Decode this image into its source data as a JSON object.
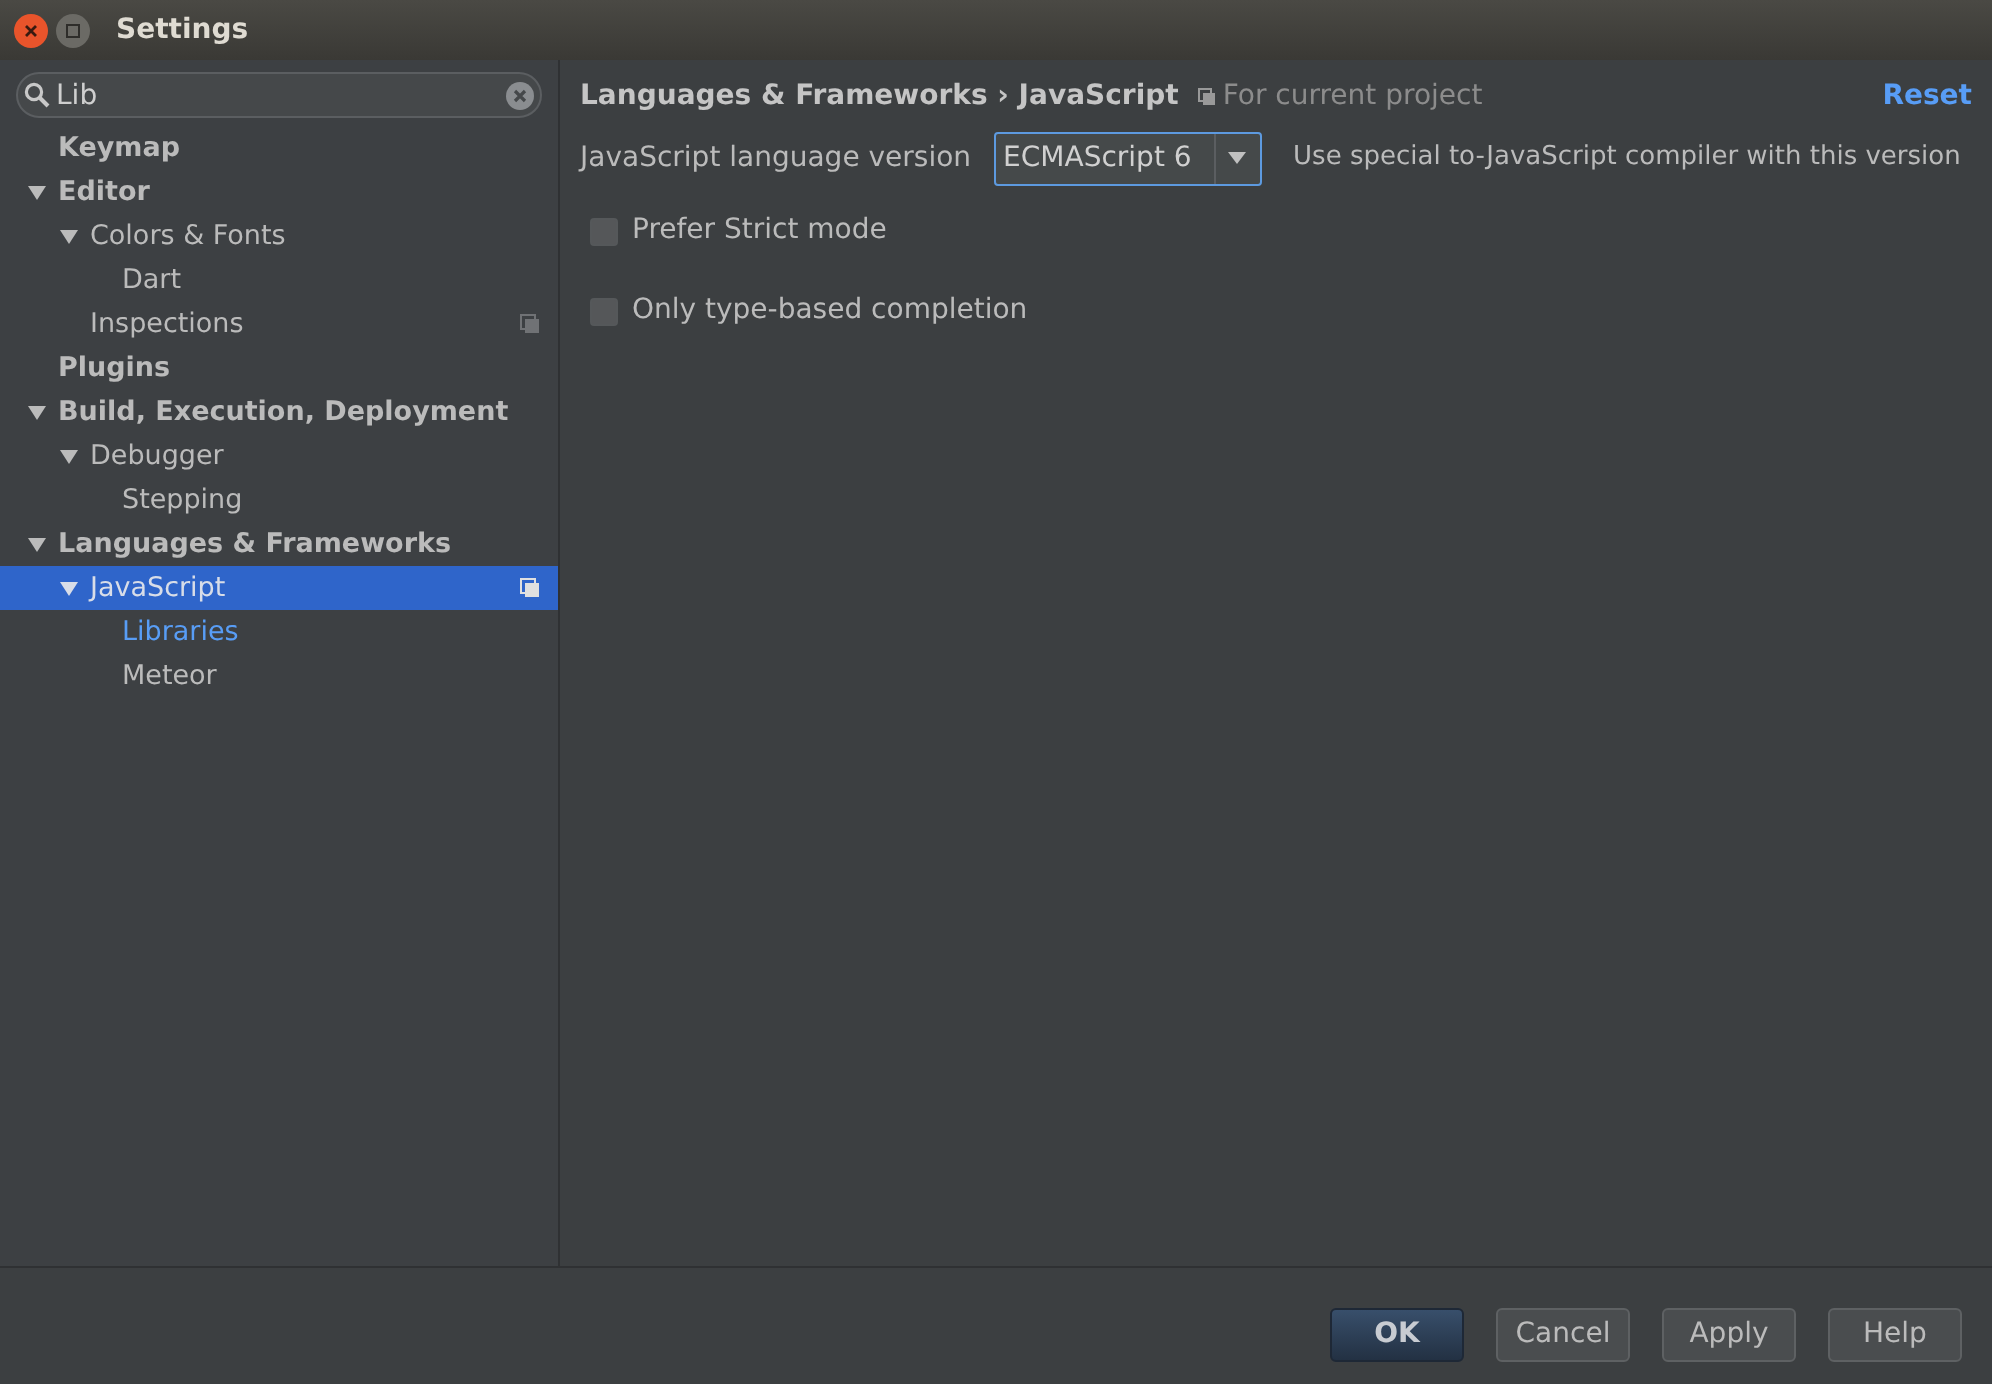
{
  "window": {
    "title": "Settings"
  },
  "search": {
    "value": "Lib"
  },
  "tree": [
    {
      "label": "Keymap",
      "selected": false
    },
    {
      "label": "Editor",
      "expanded": true,
      "selected": false,
      "children": [
        {
          "label": "Colors & Fonts",
          "expanded": true,
          "selected": false,
          "children": [
            {
              "label": "Dart",
              "selected": false
            }
          ]
        },
        {
          "label": "Inspections",
          "selected": false,
          "project_level": true
        }
      ]
    },
    {
      "label": "Plugins",
      "selected": false
    },
    {
      "label": "Build, Execution, Deployment",
      "expanded": true,
      "selected": false,
      "children": [
        {
          "label": "Debugger",
          "expanded": true,
          "selected": false,
          "children": [
            {
              "label": "Stepping",
              "selected": false
            }
          ]
        }
      ]
    },
    {
      "label": "Languages & Frameworks",
      "expanded": true,
      "selected": false,
      "children": [
        {
          "label": "JavaScript",
          "expanded": true,
          "selected": true,
          "project_level": true,
          "children": [
            {
              "label": "Libraries",
              "selected": false,
              "highlighted": true
            },
            {
              "label": "Meteor",
              "selected": false
            }
          ]
        }
      ]
    }
  ],
  "header": {
    "breadcrumb": [
      "Languages & Frameworks",
      "JavaScript"
    ],
    "separator": "›",
    "scope": "For current project",
    "reset": "Reset"
  },
  "language_version": {
    "label": "JavaScript language version",
    "value": "ECMAScript 6",
    "hint": "Use special to-JavaScript compiler with this version"
  },
  "options": [
    {
      "label": "Prefer Strict mode",
      "checked": false
    },
    {
      "label": "Only type-based completion",
      "checked": false
    }
  ],
  "buttons": [
    {
      "label": "OK",
      "default": true
    },
    {
      "label": "Cancel",
      "default": false
    },
    {
      "label": "Apply",
      "default": false
    },
    {
      "label": "Help",
      "default": false
    }
  ]
}
